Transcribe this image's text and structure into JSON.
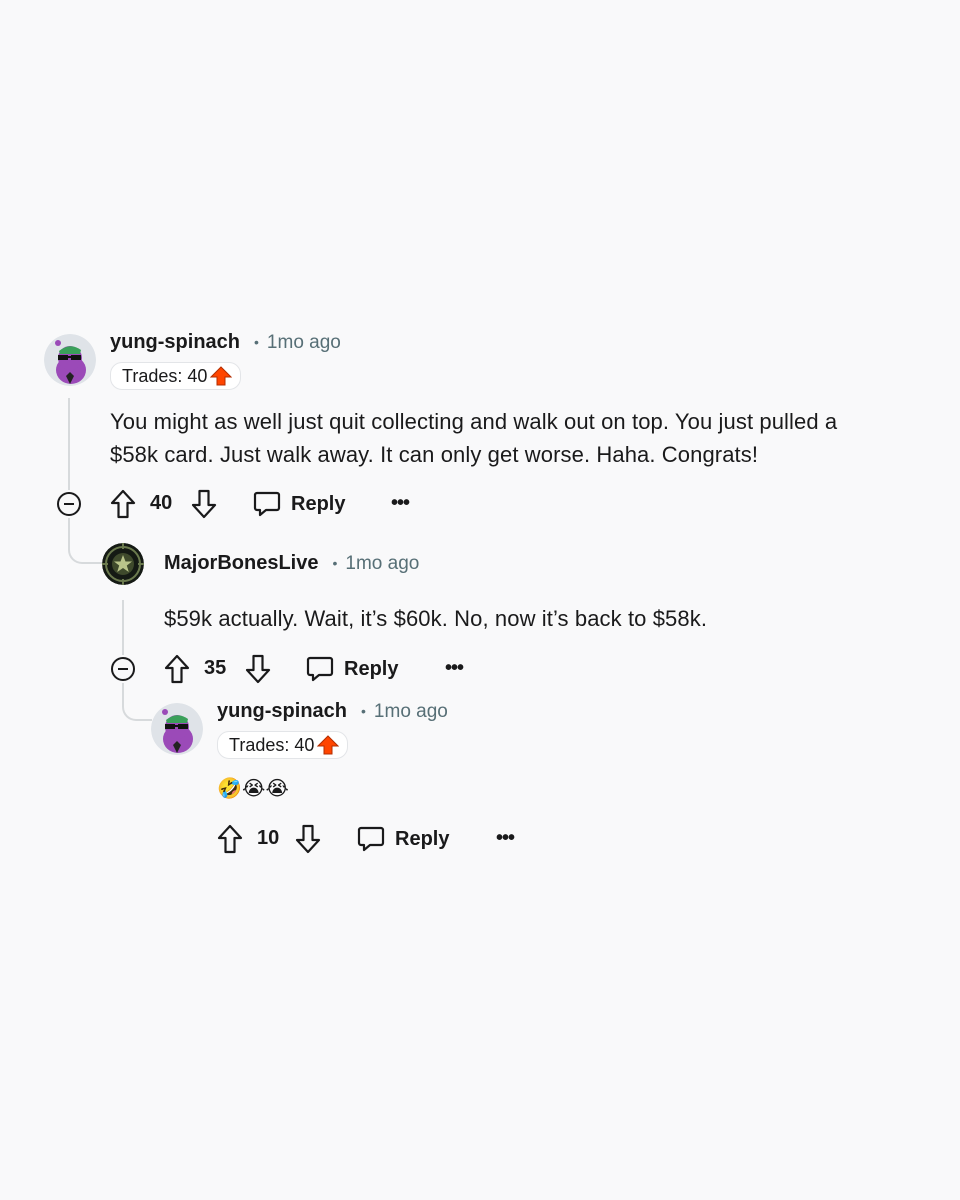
{
  "comments": [
    {
      "username": "yung-spinach",
      "separator": "•",
      "time": "1mo ago",
      "flair": "Trades: 40",
      "flair_icon": "red-up-arrow-icon",
      "body_lines": [
        "You might as well just quit collecting and walk out on top. You just pulled a",
        "$58k card. Just walk away. It can only get worse. Haha. Congrats!"
      ],
      "score": "40",
      "reply_label": "Reply",
      "more_label": "•••"
    },
    {
      "username": "MajorBonesLive",
      "separator": "•",
      "time": "1mo ago",
      "body": "$59k actually. Wait, it’s $60k. No, now it’s back to $58k.",
      "score": "35",
      "reply_label": "Reply",
      "more_label": "•••"
    },
    {
      "username": "yung-spinach",
      "separator": "•",
      "time": "1mo ago",
      "flair": "Trades: 40",
      "flair_icon": "red-up-arrow-icon",
      "body": "🤣😭😭",
      "score": "10",
      "reply_label": "Reply",
      "more_label": "•••"
    }
  ],
  "colors": {
    "background": "#f9f9fa",
    "text": "#1a1a1b",
    "meta": "#576f76",
    "thread_line": "#d7dadc",
    "flair_arrow": "#ff4500",
    "avatar_purple": "#9b4ab8"
  }
}
